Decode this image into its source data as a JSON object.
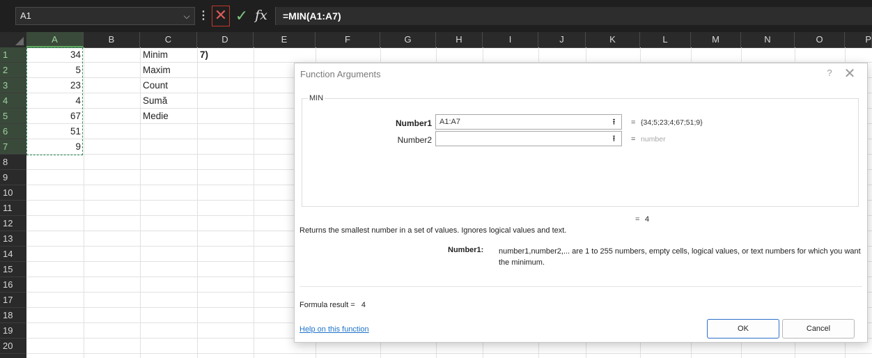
{
  "formula_bar": {
    "name_box": "A1",
    "dropdown_icon": "chevron-down-icon",
    "more_icon": "vertical-ellipsis-icon",
    "cancel_icon": "cross-icon",
    "enter_icon": "checkmark-icon",
    "fx_label": "fx",
    "formula": "=MIN(A1:A7)"
  },
  "sheet": {
    "columns": [
      "A",
      "B",
      "C",
      "D",
      "E",
      "F",
      "G",
      "H",
      "I",
      "J",
      "K",
      "L",
      "M",
      "N",
      "O",
      "P"
    ],
    "rows": [
      "1",
      "2",
      "3",
      "4",
      "5",
      "6",
      "7",
      "8",
      "9",
      "10",
      "11",
      "12",
      "13",
      "14",
      "15",
      "16",
      "17",
      "18",
      "19",
      "20"
    ],
    "cells": {
      "A1": "34",
      "A2": "5",
      "A3": "23",
      "A4": "4",
      "A5": "67",
      "A6": "51",
      "A7": "9",
      "C1": "Minim",
      "C2": "Maxim",
      "C3": "Count",
      "C4": "Sumă",
      "C5": "Medie",
      "D1": "7)"
    }
  },
  "dialog": {
    "title": "Function Arguments",
    "help": "?",
    "close": "✕",
    "function_name": "MIN",
    "args": [
      {
        "label": "Number1",
        "value": "A1:A7",
        "eq": "=",
        "result": "{34;5;23;4;67;51;9}"
      },
      {
        "label": "Number2",
        "value": "",
        "eq": "=",
        "result": "number"
      }
    ],
    "result_eq": "=",
    "result_value": "4",
    "description": "Returns the smallest number in a set of values. Ignores logical values and text.",
    "arg_help_label": "Number1:",
    "arg_help_text": "number1,number2,... are 1 to 255 numbers, empty cells, logical values, or text numbers for which you want the minimum.",
    "formula_result_label": "Formula result =",
    "formula_result_value": "4",
    "help_link": "Help on this function",
    "ok_label": "OK",
    "cancel_label": "Cancel"
  }
}
